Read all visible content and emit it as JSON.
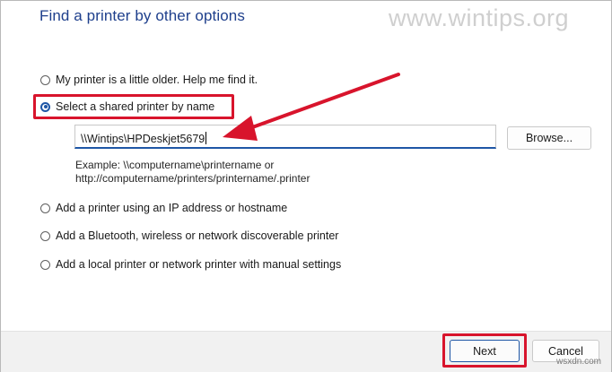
{
  "title": "Find a printer by other options",
  "watermark": "www.wintips.org",
  "watermark_small": "wsxdn.com",
  "options": [
    {
      "label": "My printer is a little older. Help me find it.",
      "checked": false
    },
    {
      "label": "Select a shared printer by name",
      "checked": true
    },
    {
      "label": "Add a printer using an IP address or hostname",
      "checked": false
    },
    {
      "label": "Add a Bluetooth, wireless or network discoverable printer",
      "checked": false
    },
    {
      "label": "Add a local printer or network printer with manual settings",
      "checked": false
    }
  ],
  "shared_printer": {
    "value": "\\\\Wintips\\HPDeskjet5679",
    "browse_label": "Browse...",
    "example_line1": "Example: \\\\computername\\printername or",
    "example_line2": "http://computername/printers/printername/.printer"
  },
  "buttons": {
    "next": "Next",
    "cancel": "Cancel"
  },
  "colors": {
    "title": "#1e3f8c",
    "highlight": "#d8142c",
    "accent": "#1f57a6"
  }
}
